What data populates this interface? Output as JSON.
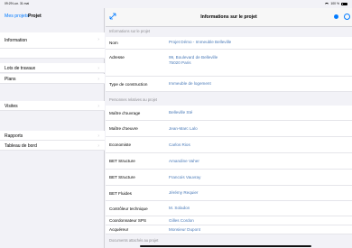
{
  "status_bar": {
    "time": "09:29  Lun. 31 mai",
    "battery": "100 %"
  },
  "sidebar": {
    "back_label": "Mes projets",
    "title": "Projet",
    "items": [
      {
        "label": "Information"
      },
      {
        "label": ""
      },
      {
        "label": "Lots de travaux"
      },
      {
        "label": "Plans"
      },
      {
        "label": "Visites"
      },
      {
        "label": "Rapports"
      },
      {
        "label": "Tableau de bord"
      }
    ]
  },
  "main": {
    "title": "Informations sur le projet",
    "sections": [
      {
        "header": "Informations sur le projet",
        "rows": [
          {
            "key": "Nom",
            "value": "Projet Démo - Immeuble Belleville"
          },
          {
            "key": "Adresse",
            "value": "99, Boulevard de Belleville",
            "value2": "75020 Paris"
          },
          {
            "key": "Type de construction",
            "value": "Immeuble de logement"
          }
        ]
      },
      {
        "header": "Personnes relatives au projet",
        "rows": [
          {
            "key": "Maître d'ouvrage",
            "value": "Belleville Sté"
          },
          {
            "key": "Maître d'oeuvre",
            "value": "Jean-Marc Lalo"
          },
          {
            "key": "Economiste",
            "value": "Carlos Rios"
          },
          {
            "key": "BET Structure",
            "value": "Amandine Vaher"
          },
          {
            "key": "BET Structure",
            "value": "Francois Vauvray"
          },
          {
            "key": "BET Fluides",
            "value": "Jérémy Requier"
          },
          {
            "key": "Contrôleur technique",
            "value": "M. Soladon"
          },
          {
            "key": "Coordonnateur SPS",
            "value": "Gilles Cordon"
          },
          {
            "key": "Acquéreur",
            "value": "Monsieur Dupont"
          }
        ]
      },
      {
        "header": "Documents attachés au projet",
        "rows": []
      }
    ]
  }
}
